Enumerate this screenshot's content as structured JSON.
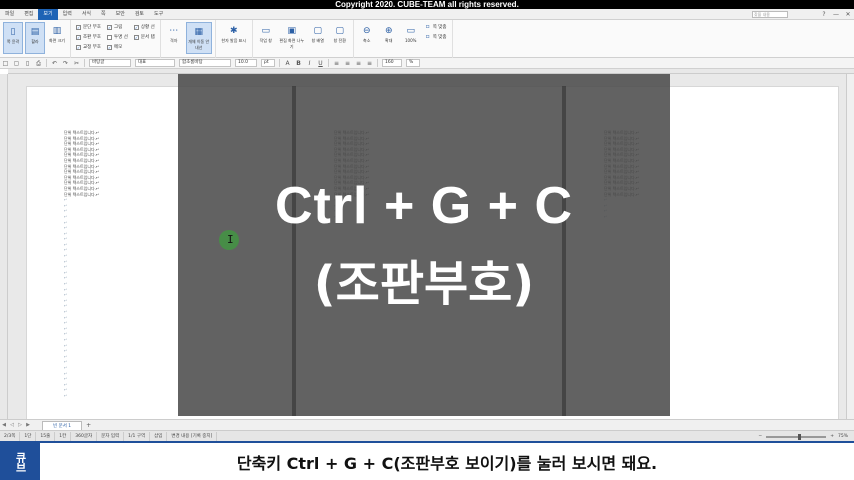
{
  "copyright": "Copyright 2020. CUBE-TEAM all rights reserved.",
  "menu": {
    "items": [
      "파일",
      "편집",
      "보기",
      "입력",
      "서식",
      "쪽",
      "보안",
      "검토",
      "도구"
    ],
    "active_index": 2,
    "search_placeholder": "찾을 내용",
    "window_buttons": [
      "?",
      "—",
      "✕"
    ]
  },
  "ribbon": {
    "view_modes": [
      {
        "icon": "▯",
        "label": "쪽 윤곽",
        "selected": true
      },
      {
        "icon": "▤",
        "label": "할라",
        "selected": true
      },
      {
        "icon": "▥",
        "label": "화면 크기",
        "selected": false
      }
    ],
    "checks_col1": [
      {
        "label": "문단 부호",
        "checked": true
      },
      {
        "label": "조판 부호",
        "checked": true
      },
      {
        "label": "교정 부호",
        "checked": true
      }
    ],
    "checks_col2": [
      {
        "label": "그림",
        "checked": true
      },
      {
        "label": "투명 선",
        "checked": false
      },
      {
        "label": "메모",
        "checked": true
      }
    ],
    "checks_col3": [
      {
        "label": "상황 선",
        "checked": true
      },
      {
        "label": "문서 탭",
        "checked": true
      }
    ],
    "grid_buttons": [
      {
        "icon": "⋯",
        "label": "격자"
      },
      {
        "icon": "▦",
        "label": "개체 이동 안내선"
      }
    ],
    "hanja_button": {
      "icon": "✱",
      "label": "한자 발음 표시"
    },
    "layout_buttons": [
      {
        "icon": "▭",
        "label": "작업 창"
      },
      {
        "icon": "▣",
        "label": "편집 화면 나누기"
      },
      {
        "icon": "▢",
        "label": "창 배열"
      },
      {
        "icon": "▢",
        "label": "창 전환"
      }
    ],
    "zoom_buttons": [
      {
        "icon": "⊖",
        "label": "축소"
      },
      {
        "icon": "⊕",
        "label": "확대"
      }
    ],
    "zoom_percent": {
      "icon": "▭",
      "label": "100%"
    },
    "fit_options": [
      {
        "label": "쪽 맞춤"
      },
      {
        "label": "쪽 맞춤"
      }
    ]
  },
  "toolbar": {
    "style_combo": "바탕글",
    "lang_combo": "대표",
    "font_combo": "함초롬바탕",
    "size_value": "10.0",
    "size_unit": "pt",
    "zoom_value": "160",
    "zoom_unit": "%",
    "icons": [
      "□",
      "▢",
      "▯",
      "⎙",
      "↶",
      "↷",
      "✂",
      "A",
      "B",
      "I",
      "U"
    ]
  },
  "document": {
    "page_line_text": "단위 텍스트입니다.",
    "filled_lines": 12,
    "empty_lines": 36,
    "return_mark": "↵"
  },
  "overlay": {
    "shortcut": "Ctrl + G + C",
    "function": "(조판부호)"
  },
  "tabs": {
    "nav_arrows": [
      "◀",
      "◁",
      "▷",
      "▶"
    ],
    "doc_tab": "빈 문서 1",
    "add_label": "+"
  },
  "status": {
    "items": [
      "2/3쪽",
      "1단",
      "15줄",
      "1칸",
      "360글자",
      "문자 입력",
      "1/1 구역",
      "삽입",
      "변경 내용 [기록 중지]"
    ],
    "zoom_label": "75%",
    "zoom_fraction": 0.55
  },
  "subtitle": {
    "logo": "큐브",
    "text": "단축키 Ctrl + G + C(조판부호 보이기)를 눌러 보시면 돼요."
  }
}
